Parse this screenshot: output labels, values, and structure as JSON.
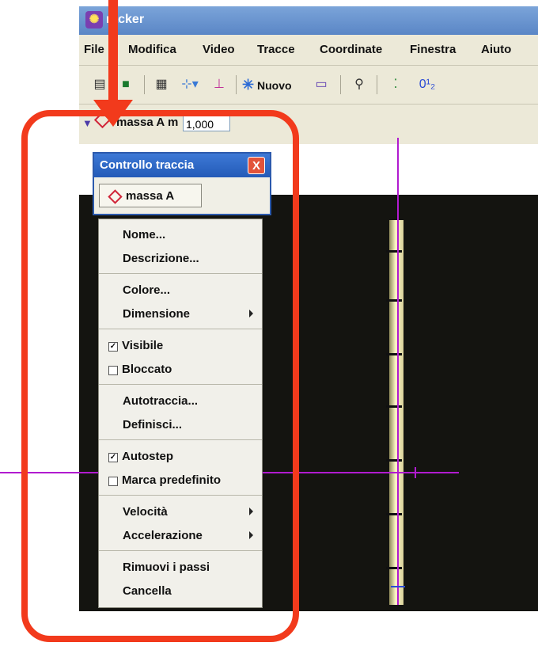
{
  "window": {
    "title": "racker",
    "logo_glyph": "✺"
  },
  "menu_bar": [
    "File",
    "Modifica",
    "Video",
    "Tracce",
    "Coordinate",
    "Finestra",
    "Aiuto"
  ],
  "toolbar": {
    "new_label": "Nuovo",
    "tick_glyph": "0¹₂"
  },
  "track_bar": {
    "track_name": "massa A",
    "mass_label": "m",
    "mass_value": "1,000"
  },
  "track_control": {
    "title": "Controllo traccia",
    "close_glyph": "X",
    "track_button_label": "massa A"
  },
  "track_menu": {
    "items": [
      {
        "label": "Nome...",
        "checkbox": null,
        "submenu": false
      },
      {
        "label": "Descrizione...",
        "checkbox": null,
        "submenu": false
      },
      {
        "label": "Colore...",
        "checkbox": null,
        "submenu": false
      },
      {
        "label": "Dimensione",
        "checkbox": null,
        "submenu": true
      },
      {
        "label": "Visibile",
        "checkbox": true,
        "submenu": false
      },
      {
        "label": "Bloccato",
        "checkbox": false,
        "submenu": false
      },
      {
        "label": "Autotraccia...",
        "checkbox": null,
        "submenu": false
      },
      {
        "label": "Definisci...",
        "checkbox": null,
        "submenu": false
      },
      {
        "label": "Autostep",
        "checkbox": true,
        "submenu": false
      },
      {
        "label": "Marca predefinito",
        "checkbox": false,
        "submenu": false
      },
      {
        "label": "Velocità",
        "checkbox": null,
        "submenu": true
      },
      {
        "label": "Accelerazione",
        "checkbox": null,
        "submenu": true
      },
      {
        "label": "Rimuovi i passi",
        "checkbox": null,
        "submenu": false
      },
      {
        "label": "Cancella",
        "checkbox": null,
        "submenu": false
      }
    ]
  },
  "colors": {
    "annotation": "#f23a1c",
    "crosshair": "#b11bd0",
    "title_bar": "#3d79d6"
  }
}
